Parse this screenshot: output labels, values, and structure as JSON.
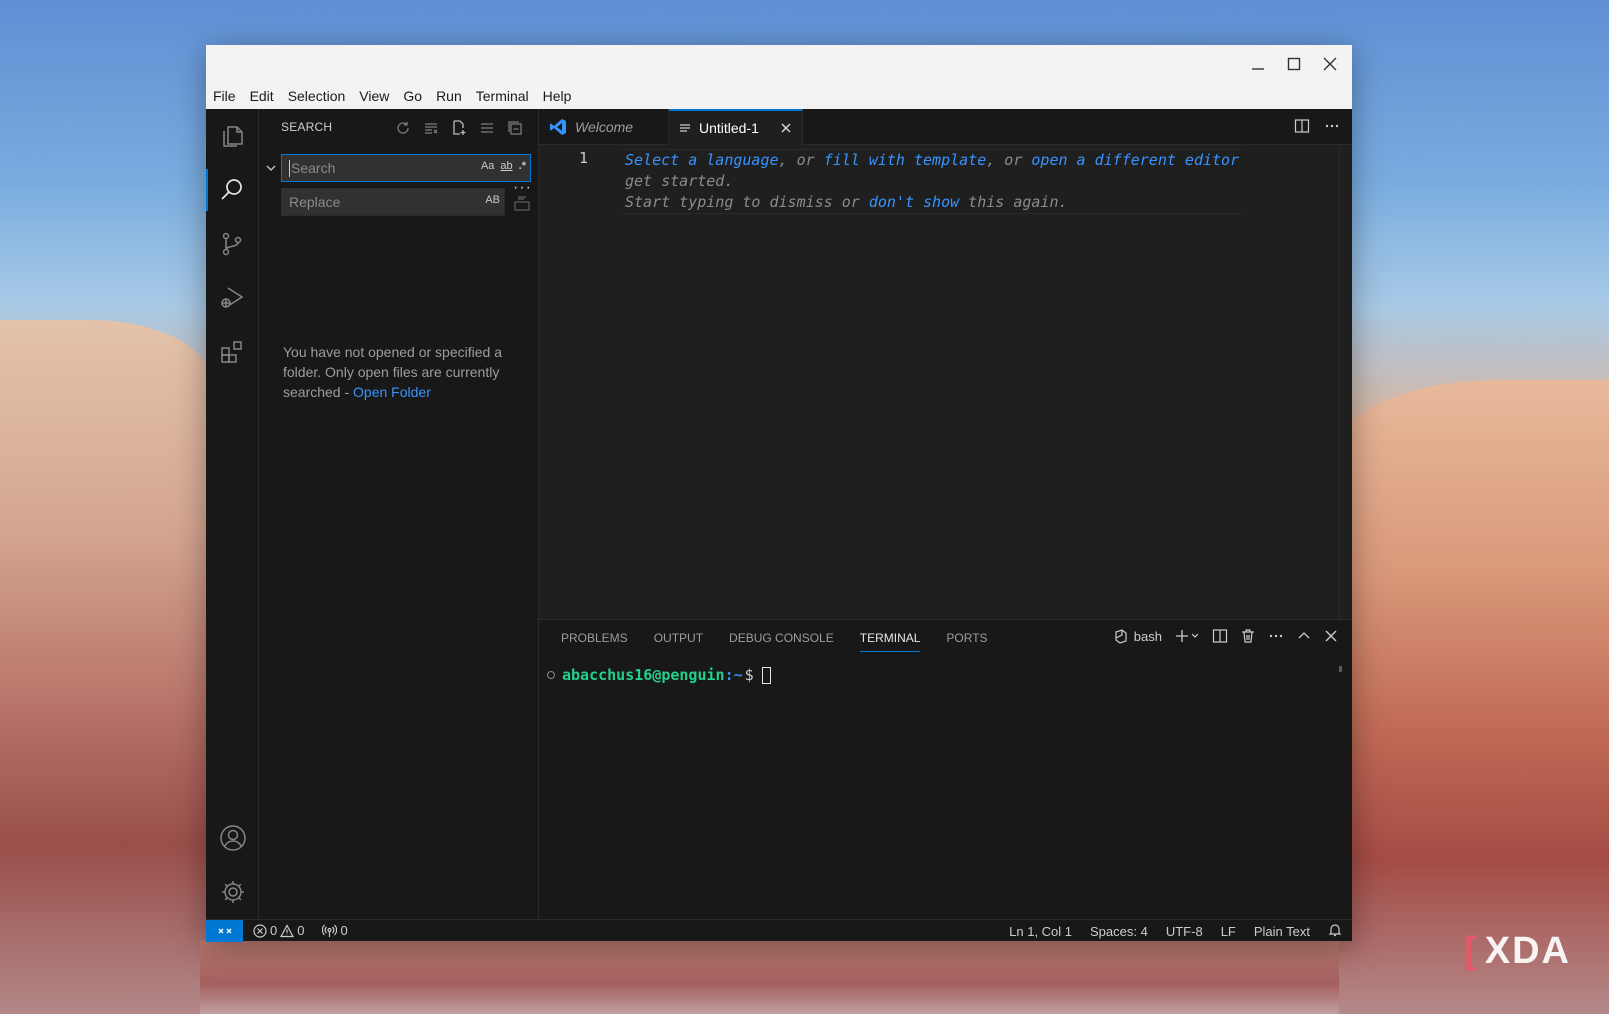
{
  "menu": [
    "File",
    "Edit",
    "Selection",
    "View",
    "Go",
    "Run",
    "Terminal",
    "Help"
  ],
  "sidebar": {
    "title": "SEARCH",
    "search_placeholder": "Search",
    "replace_placeholder": "Replace",
    "match_case": "Aa",
    "whole_word": "ab",
    "regex": ".*",
    "preserve_case": "AB",
    "message_text": "You have not opened or specified a folder. Only open files are currently searched - ",
    "message_link": "Open Folder"
  },
  "tabs": [
    {
      "label": "Welcome"
    },
    {
      "label": "Untitled-1"
    }
  ],
  "editor": {
    "line_number": "1",
    "hint": {
      "link1": "Select a language",
      "sep1": ", or ",
      "link2": "fill with template",
      "sep2": ", or ",
      "link3": "open a different editor",
      "line2": "get started.",
      "line3_a": "Start typing to dismiss or ",
      "link4": "don't show",
      "line3_b": " this again."
    }
  },
  "panel": {
    "tabs": [
      "PROBLEMS",
      "OUTPUT",
      "DEBUG CONSOLE",
      "TERMINAL",
      "PORTS"
    ],
    "active_tab": "TERMINAL",
    "shell": "bash",
    "terminal": {
      "user_host": "abacchus16@penguin",
      "path": ":~",
      "symbol": "$"
    }
  },
  "statusbar": {
    "errors": "0",
    "warnings": "0",
    "ports": "0",
    "position": "Ln 1, Col 1",
    "spaces": "Spaces: 4",
    "encoding": "UTF-8",
    "eol": "LF",
    "language": "Plain Text"
  },
  "watermark": "XDA",
  "colors": {
    "accent": "#0078d4",
    "link": "#3794ff",
    "terminal_user": "#23d18b",
    "terminal_path": "#3b8eea"
  }
}
